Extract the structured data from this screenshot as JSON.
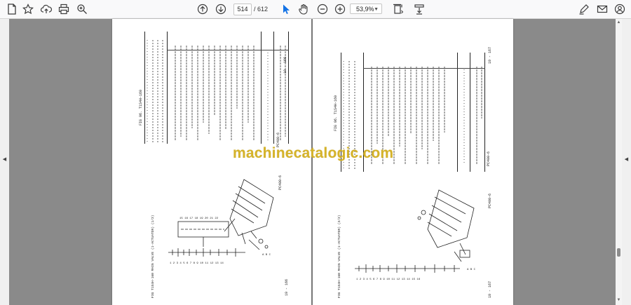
{
  "toolbar": {
    "page_current": "514",
    "page_total": "/ 612",
    "zoom": "53,9%",
    "icons": [
      "document-icon",
      "star-icon",
      "cloud-upload-icon",
      "print-icon",
      "zoom-search-icon",
      "arrow-up-icon",
      "arrow-down-icon",
      "cursor-icon",
      "hand-icon",
      "zoom-out-icon",
      "zoom-in-icon",
      "fit-page-icon",
      "scroll-mode-icon",
      "pen-sign-icon",
      "mail-icon",
      "account-icon"
    ]
  },
  "watermark": "machinecatalogic.com",
  "left_page": {
    "fig_title": "FIG 96. T1S4H-160",
    "page_number": "19 - 166",
    "code": "PC400-6",
    "drawing_caption": "FIG T1S4H-160 MAIN VALVE (1-ACTUATOR) (1/2)",
    "col_headers": [
      "INDEX",
      "PART NO.",
      "DESCRIPTION",
      "Q'TY",
      "SERIAL NO."
    ]
  },
  "right_page": {
    "fig_title": "FIG 96. T1S4H-160",
    "page_number": "19 - 167",
    "code": "PC400-6",
    "drawing_caption": "FIG T1S4H-160 MAIN VALVE (1-ACTUATOR) (2/2)",
    "col_headers": [
      "INDEX",
      "PART NO.",
      "DESCRIPTION",
      "Q'TY",
      "SERIAL NO."
    ]
  }
}
